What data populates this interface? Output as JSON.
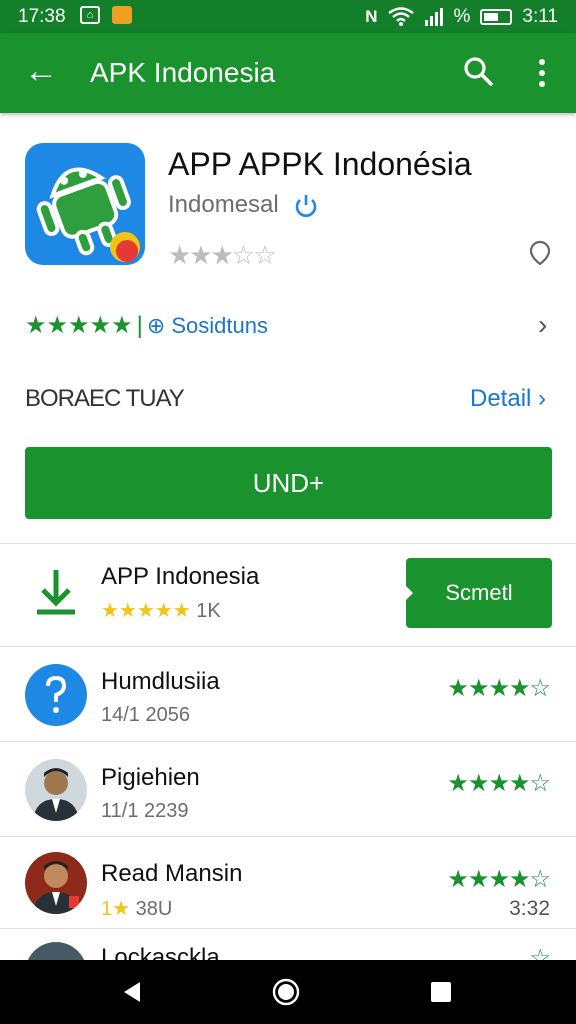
{
  "status_bar": {
    "time": "17:38",
    "battery_text": "%",
    "clock": "3:11"
  },
  "app_bar": {
    "title": "APK Indonesia"
  },
  "app": {
    "name": "APP APPK Indonésia",
    "developer": "Indomesal",
    "grey_rating": "★★★☆☆",
    "rating_row": {
      "green_stars": "★★★★★",
      "sep": "|",
      "positions_label": "⊕ Sosidtuns"
    }
  },
  "section": {
    "label": "BORAEC TUAY",
    "detail_label": "Detail"
  },
  "install_button": {
    "label": "UND+"
  },
  "featured": {
    "title": "APP Indonesia",
    "stars": "★★★★★",
    "count": "1K",
    "button_label": "Scmetl"
  },
  "reviews": [
    {
      "name": "Humdlusiia",
      "meta": "14/1 2056",
      "stars": "★★★★☆",
      "time": ""
    },
    {
      "name": "Pigiehien",
      "meta": "11/1 2239",
      "stars": "★★★★☆",
      "time": ""
    },
    {
      "name": "Read Mansin",
      "meta_star": "1★",
      "meta": "38U",
      "stars": "★★★★☆",
      "time": "3:32"
    },
    {
      "name": "Lockasckla",
      "meta": "",
      "stars": "☆",
      "time": ""
    }
  ],
  "colors": {
    "brand_green": "#1a922e",
    "status_green": "#137f2a",
    "link_blue": "#1976d2",
    "star_yellow": "#f2c318"
  },
  "icons": [
    "back-arrow-icon",
    "search-icon",
    "more-vert-icon",
    "android-app-icon",
    "refresh-icon",
    "pin-icon",
    "chevron-right-icon",
    "download-icon",
    "question-icon",
    "nav-back-icon",
    "nav-home-icon",
    "nav-recents-icon"
  ]
}
